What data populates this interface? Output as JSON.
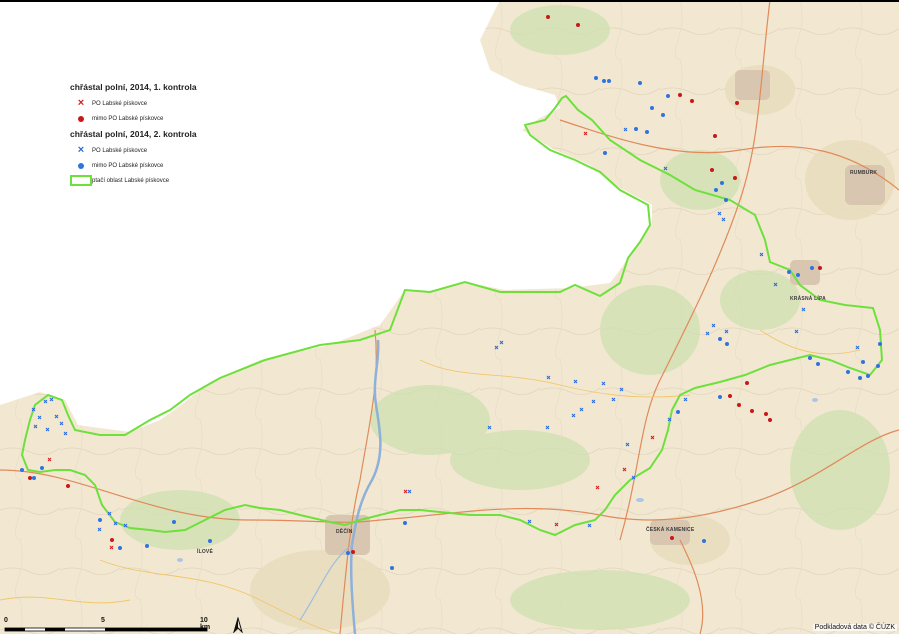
{
  "legend": {
    "group1_title": "chřástal polní, 2014, 1. kontrola",
    "group1_item_po": "PO Labské pískovce",
    "group1_item_mimo": "mimo PO Labské pískovce",
    "group2_title": "chřástal polní, 2014, 2. kontrola",
    "group2_item_po": "PO Labské pískovce",
    "group2_item_mimo": "mimo PO Labské pískovce",
    "boundary": "ptačí oblast Labské pískovce"
  },
  "scale": {
    "label_0": "0",
    "label_5": "5",
    "label_10": "10 km"
  },
  "credit": "Podkladová data © ČÚZK",
  "towns": {
    "decin": "DĚČÍN",
    "ceska_kamenice": "ČESKÁ KAMENICE",
    "rumburk": "RUMBURK",
    "krasna_lipa": "KRÁSNÁ LÍPA",
    "ilove": "ÍLOVÉ"
  },
  "colors": {
    "first_control": "#d02020",
    "second_control": "#2d6bd6",
    "boundary": "#6ee03c",
    "map_base": "#f2e9d6"
  },
  "icons": {
    "po_symbol": "cross",
    "mimo_symbol": "dot",
    "north_arrow": "north-arrow-icon"
  }
}
